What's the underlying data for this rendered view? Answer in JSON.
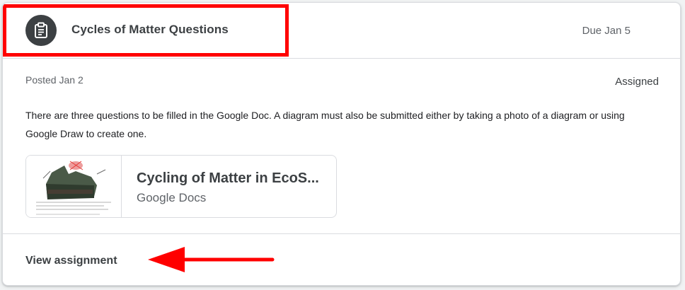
{
  "assignment": {
    "title": "Cycles of Matter Questions",
    "due": "Due Jan 5",
    "icon": "assignment-icon",
    "posted": "Posted Jan 2",
    "status": "Assigned",
    "description": "There are three questions to be filled in the Google Doc. A diagram must also be submitted either by taking a photo of a diagram or using Google Draw to create one."
  },
  "attachment": {
    "title": "Cycling of Matter in EcoS...",
    "type": "Google Docs",
    "thumbnail_icon": "document-thumbnail"
  },
  "footer": {
    "view_label": "View assignment"
  },
  "annotations": {
    "highlight_color": "#ff0000",
    "arrow_color": "#ff0000"
  }
}
